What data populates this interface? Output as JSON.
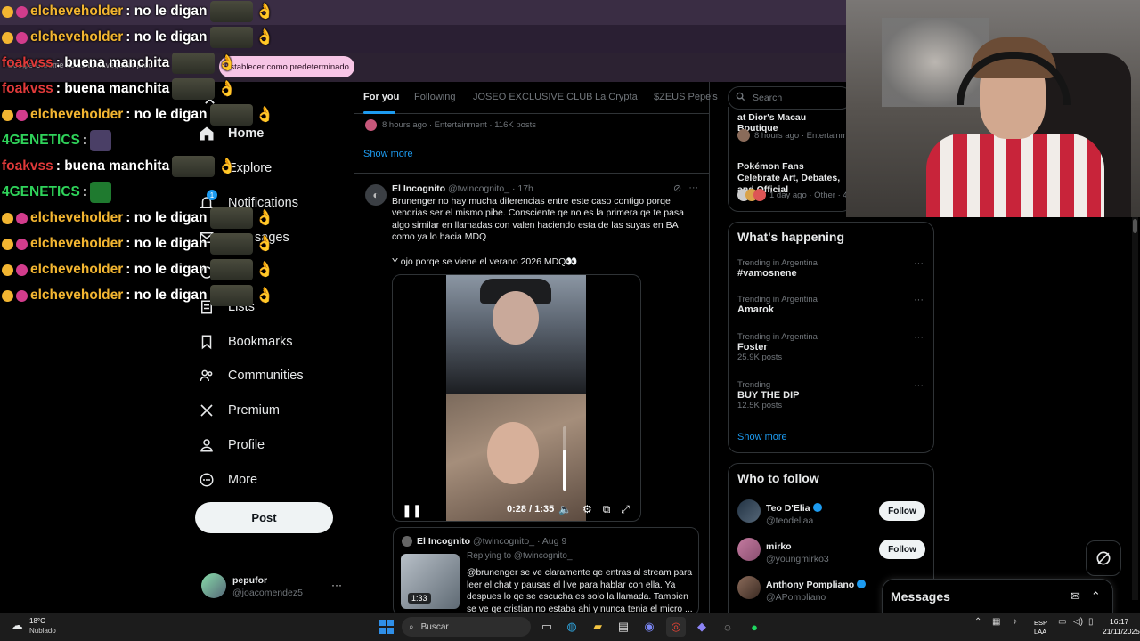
{
  "browser": {
    "notice": "Google Chrome no es tu navegador pred",
    "default_button": "Establecer como predeterminado"
  },
  "chat": [
    {
      "user": "elcheveholder",
      "color": "orange",
      "text": ": no le digan",
      "badges": true
    },
    {
      "user": "elcheveholder",
      "color": "orange",
      "text": ": no le digan",
      "badges": true
    },
    {
      "user": "foakvss",
      "color": "red",
      "text": ": buena manchita",
      "badges": false
    },
    {
      "user": "foakvss",
      "color": "red",
      "text": ": buena manchita",
      "badges": false
    },
    {
      "user": "elcheveholder",
      "color": "orange",
      "text": ": no le digan",
      "badges": true
    },
    {
      "user": "4GENETICS",
      "color": "green",
      "text": ":",
      "badges": false
    },
    {
      "user": "foakvss",
      "color": "red",
      "text": ": buena manchita",
      "badges": false
    },
    {
      "user": "4GENETICS",
      "color": "green",
      "text": ":",
      "badges": false
    },
    {
      "user": "elcheveholder",
      "color": "orange",
      "text": ": no le digan",
      "badges": true
    },
    {
      "user": "elcheveholder",
      "color": "orange",
      "text": ": no le digan",
      "badges": true
    },
    {
      "user": "elcheveholder",
      "color": "orange",
      "text": ": no le digan",
      "badges": true
    },
    {
      "user": "elcheveholder",
      "color": "orange",
      "text": ": no le digan",
      "badges": true
    }
  ],
  "nav": {
    "home": "Home",
    "explore": "Explore",
    "notifications": "Notifications",
    "notifications_badge": "1",
    "messages_partial": "sages",
    "lists": "Lists",
    "bookmarks": "Bookmarks",
    "communities": "Communities",
    "premium": "Premium",
    "profile": "Profile",
    "more": "More",
    "post": "Post"
  },
  "account": {
    "name": "pepufor",
    "handle": "@joacomendez5",
    "more": "···"
  },
  "tabs": [
    "For you",
    "Following",
    "JOSEO EXCLUSIVE CLUB",
    "La Crypta",
    "$ZEUS Pepe's"
  ],
  "prev_meta": "8 hours ago · Entertainment · 116K posts",
  "show_more": "Show more",
  "tweet": {
    "name": "El Incognito",
    "handle": "@twincognito_",
    "time": "· 17h",
    "body": "Brunenger no hay mucha diferencias entre este caso contigo porqe vendrias ser el mismo pibe. Consciente qe no es la primera qe te pasa algo similar en llamadas con valen haciendo esta de las suyas en BA como ya lo hacia MDQ",
    "body2": "Y ojo porqe se viene el verano 2026 MDQ👀",
    "video_time": "0:28 / 1:35",
    "volume": 0.64
  },
  "quote": {
    "name": "El Incognito",
    "handle": "@twincognito_",
    "time": "· Aug 9",
    "replying": "Replying to @twincognito_",
    "duration": "1:33",
    "body": "@brunenger se ve claramente qe entras al stream para leer el chat y pausas el live para hablar con ella. Ya despues lo qe se escucha es solo la llamada. Tambien se ve qe cristian no estaba ahi y nunca tenia el micro ..."
  },
  "search": {
    "placeholder": "Search"
  },
  "top_trends": [
    {
      "title": "at Dior's Macau Boutique",
      "meta": "8 hours ago · Entertainm"
    },
    {
      "title": "Pokémon Fans Celebrate Art, Debates, and Official",
      "meta": "1 day ago · Other · 48"
    }
  ],
  "happening": {
    "title": "What's happening",
    "items": [
      {
        "context": "Trending in Argentina",
        "name": "#vamosnene",
        "count": ""
      },
      {
        "context": "Trending in Argentina",
        "name": "Amarok",
        "count": ""
      },
      {
        "context": "Trending in Argentina",
        "name": "Foster",
        "count": "25.9K posts"
      },
      {
        "context": "Trending",
        "name": "BUY THE DIP",
        "count": "12.5K posts"
      }
    ],
    "show_more": "Show more"
  },
  "who_to_follow": {
    "title": "Who to follow",
    "users": [
      {
        "name": "Teo D'Elia",
        "handle": "@teodeliaa",
        "button": "Follow",
        "verified": true
      },
      {
        "name": "mirko",
        "handle": "@youngmirko3",
        "button": "Follow",
        "verified": false
      },
      {
        "name": "Anthony Pompliano",
        "handle": "@APompliano",
        "button": "",
        "verified": true
      }
    ]
  },
  "messages": {
    "title": "Messages"
  },
  "taskbar": {
    "temp": "18°C",
    "weather": "Nublado",
    "search": "Buscar",
    "lang1": "ESP",
    "lang2": "LAA",
    "time": "16:17",
    "date": "21/11/2025"
  },
  "colors": {
    "accent": "#1d9bf0",
    "bg": "#000000",
    "chat_orange": "#f2b531",
    "chat_red": "#e13a3a",
    "chat_green": "#2fd35a"
  }
}
